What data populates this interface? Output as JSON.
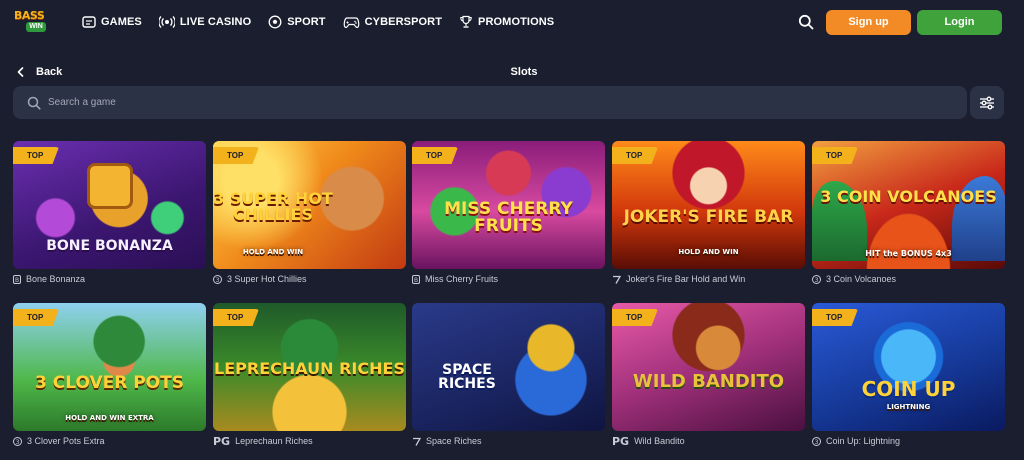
{
  "header": {
    "logo_text": "BASS",
    "logo_sub": "WIN",
    "nav": [
      {
        "label": "GAMES",
        "icon": "games-icon"
      },
      {
        "label": "LIVE CASINO",
        "icon": "live-casino-icon"
      },
      {
        "label": "SPORT",
        "icon": "sport-ball-icon"
      },
      {
        "label": "CYBERSPORT",
        "icon": "gamepad-icon"
      },
      {
        "label": "PROMOTIONS",
        "icon": "trophy-icon"
      }
    ],
    "signup_label": "Sign up",
    "login_label": "Login"
  },
  "subheader": {
    "back_label": "Back",
    "title": "Slots"
  },
  "search": {
    "placeholder": "Search a game"
  },
  "colors": {
    "background": "#1b1e2e",
    "panel": "#2c3246",
    "signup": "#f28a26",
    "login": "#3fa23b",
    "badge": "#f3b21b"
  },
  "games": [
    {
      "name": "Bone Bonanza",
      "art_title": "BONE BONANZA",
      "badge": "TOP",
      "provider": "B"
    },
    {
      "name": "3 Super Hot Chillies",
      "art_title": "3 SUPER HOT CHILLIES",
      "art_sub": "HOLD AND WIN",
      "badge": "TOP",
      "provider": "3"
    },
    {
      "name": "Miss Cherry Fruits",
      "art_title": "MISS CHERRY FRUITS",
      "badge": "TOP",
      "provider": "B"
    },
    {
      "name": "Joker's Fire Bar Hold and Win",
      "art_title": "JOKER'S FIRE BAR",
      "art_sub": "HOLD AND WIN",
      "badge": "TOP",
      "provider": "7"
    },
    {
      "name": "3 Coin Volcanoes",
      "art_title": "3 COIN VOLCANOES",
      "art_sub": "HIT the BONUS 4x3",
      "badge": "TOP",
      "provider": "3"
    },
    {
      "name": "3 Clover Pots Extra",
      "art_title": "3 CLOVER POTS",
      "art_sub": "HOLD AND WIN EXTRA",
      "badge": "TOP",
      "provider": "3"
    },
    {
      "name": "Leprechaun Riches",
      "art_title": "LEPRECHAUN RICHES",
      "badge": "TOP",
      "provider": "PG"
    },
    {
      "name": "Space Riches",
      "art_title": "SPACE RICHES",
      "badge": "",
      "provider": "7"
    },
    {
      "name": "Wild Bandito",
      "art_title": "WILD BANDITO",
      "badge": "TOP",
      "provider": "PG"
    },
    {
      "name": "Coin Up: Lightning",
      "art_title": "COIN UP",
      "art_sub": "LIGHTNING",
      "badge": "TOP",
      "provider": "3"
    }
  ]
}
